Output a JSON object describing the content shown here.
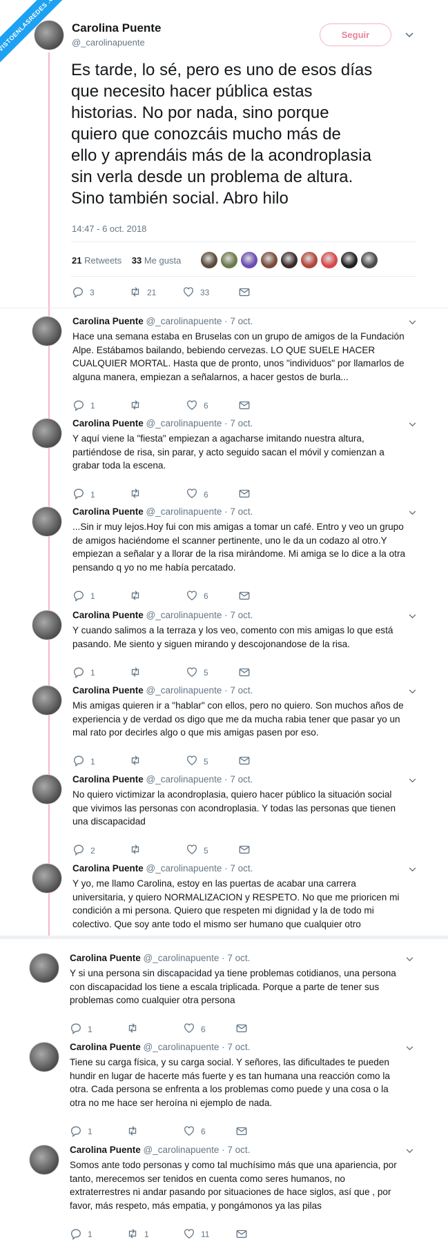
{
  "watermark": "VISTOENLASREDES .COM",
  "main": {
    "name": "Carolina Puente",
    "handle": "@_carolinapuente",
    "follow_label": "Seguir",
    "text_lines": [
      "Es tarde, lo sé, pero es uno de esos días",
      "que necesito hacer pública estas",
      "historias. No por nada, sino porque",
      "quiero que conozcáis mucho más de",
      "ello y aprendáis más de la acondroplasia",
      "sin verla desde un problema de altura.",
      "Sino también social. Abro hilo"
    ],
    "timestamp": "14:47 - 6 oct. 2018",
    "retweets_count": "21",
    "retweets_label": "Retweets",
    "likes_count": "33",
    "likes_label": "Me gusta",
    "replies": "3",
    "rts": "21",
    "hearts": "33",
    "liker_colors": [
      "#5a4a3a",
      "#6b7a4a",
      "#6c4bb5",
      "#7a4a3a",
      "#3a2a2a",
      "#b3453a",
      "#d9474c",
      "#222222",
      "#4a4a4a"
    ]
  },
  "replies": [
    {
      "name": "Carolina Puente",
      "handle": "@_carolinapuente · 7 oct.",
      "lines": [
        "Hace una semana estaba en Bruselas con un grupo de amigos de la Fundación",
        "Alpe. Estábamos bailando, bebiendo cervezas. LO QUE SUELE HACER",
        "CUALQUIER MORTAL. Hasta que de pronto, unos \"individuos\" por llamarlos de",
        "alguna manera, empiezan a señalarnos, a hacer gestos de burla..."
      ],
      "replies": "1",
      "rts": "",
      "hearts": "6"
    },
    {
      "name": "Carolina Puente",
      "handle": "@_carolinapuente · 7 oct.",
      "lines": [
        "Y aquí viene la \"fiesta\" empiezan a agacharse imitando nuestra altura,",
        "partiéndose de risa, sin parar, y acto seguido sacan el móvil y comienzan a",
        "grabar toda la escena."
      ],
      "replies": "1",
      "rts": "",
      "hearts": "6"
    },
    {
      "name": "Carolina Puente",
      "handle": "@_carolinapuente · 7 oct.",
      "lines": [
        "...Sin ir muy lejos.Hoy fui con mis amigas a tomar un café. Entro y veo un grupo",
        "de amigos haciéndome el scanner pertinente, uno le da un codazo al otro.Y",
        "empiezan a señalar y a llorar de la risa mirándome. Mi amiga se lo dice a la otra",
        "pensando q yo no me había percatado."
      ],
      "replies": "1",
      "rts": "",
      "hearts": "6"
    },
    {
      "name": "Carolina Puente",
      "handle": "@_carolinapuente · 7 oct.",
      "lines": [
        "Y cuando salimos a la terraza y los veo, comento con mis amigas lo que está",
        "pasando. Me siento y siguen mirando y descojonandose de la risa."
      ],
      "replies": "1",
      "rts": "",
      "hearts": "5"
    },
    {
      "name": "Carolina Puente",
      "handle": "@_carolinapuente · 7 oct.",
      "lines": [
        "Mis amigas quieren ir a \"hablar\" con ellos, pero no quiero. Son muchos años de",
        "experiencia y de verdad os digo que me da mucha rabia tener que pasar yo un",
        "mal rato por decirles algo o  que mis amigas pasen por eso."
      ],
      "replies": "1",
      "rts": "",
      "hearts": "5"
    },
    {
      "name": "Carolina Puente",
      "handle": "@_carolinapuente · 7 oct.",
      "lines": [
        "No quiero victimizar la acondroplasia, quiero hacer público la situación social",
        "que vivimos las personas con acondroplasia. Y todas las personas que tienen",
        "una discapacidad"
      ],
      "replies": "2",
      "rts": "",
      "hearts": "5"
    },
    {
      "name": "Carolina Puente",
      "handle": "@_carolinapuente · 7 oct.",
      "lines": [
        "Y yo, me llamo Carolina, estoy en las puertas de acabar una carrera",
        "universitaria, y quiero NORMALIZACION y RESPETO. No que me prioricen mi",
        "condición a mi persona. Quiero que respeten mi dignidad y la de todo mi",
        "colectivo. Que soy ante todo el mismo ser humano que cualquier otro"
      ],
      "replies": "",
      "rts": "",
      "hearts": ""
    }
  ],
  "lower_replies": [
    {
      "name": "Carolina Puente",
      "handle": "@_carolinapuente · 7 oct.",
      "lines": [
        "Y si una persona sin discapacidad ya tiene problemas cotidianos, una persona",
        "con discapacidad los tiene a escala triplicada. Porque a parte de tener sus",
        "problemas como cualquier otra persona"
      ],
      "replies": "1",
      "rts": "",
      "hearts": "6"
    },
    {
      "name": "Carolina Puente",
      "handle": "@_carolinapuente · 7 oct.",
      "lines": [
        "Tiene su carga física, y su carga social. Y señores, las dificultades te pueden",
        "hundir en lugar de hacerte más fuerte y es tan humana una reacción como la",
        "otra. Cada persona se enfrenta a los problemas como puede y una cosa o la",
        "otra no me hace ser heroína ni ejemplo de nada."
      ],
      "replies": "1",
      "rts": "",
      "hearts": "6"
    },
    {
      "name": "Carolina Puente",
      "handle": "@_carolinapuente · 7 oct.",
      "lines": [
        "Somos ante todo personas  y como tal  muchísimo más que una apariencia, por",
        "tanto, merecemos ser tenidos en cuenta como seres humanos, no",
        "extraterrestres ni andar pasando por situaciones de hace siglos, así que , por",
        "favor, más respeto, más empatia, y pongámonos ya las pilas"
      ],
      "replies": "1",
      "rts": "1",
      "hearts": "11"
    }
  ]
}
